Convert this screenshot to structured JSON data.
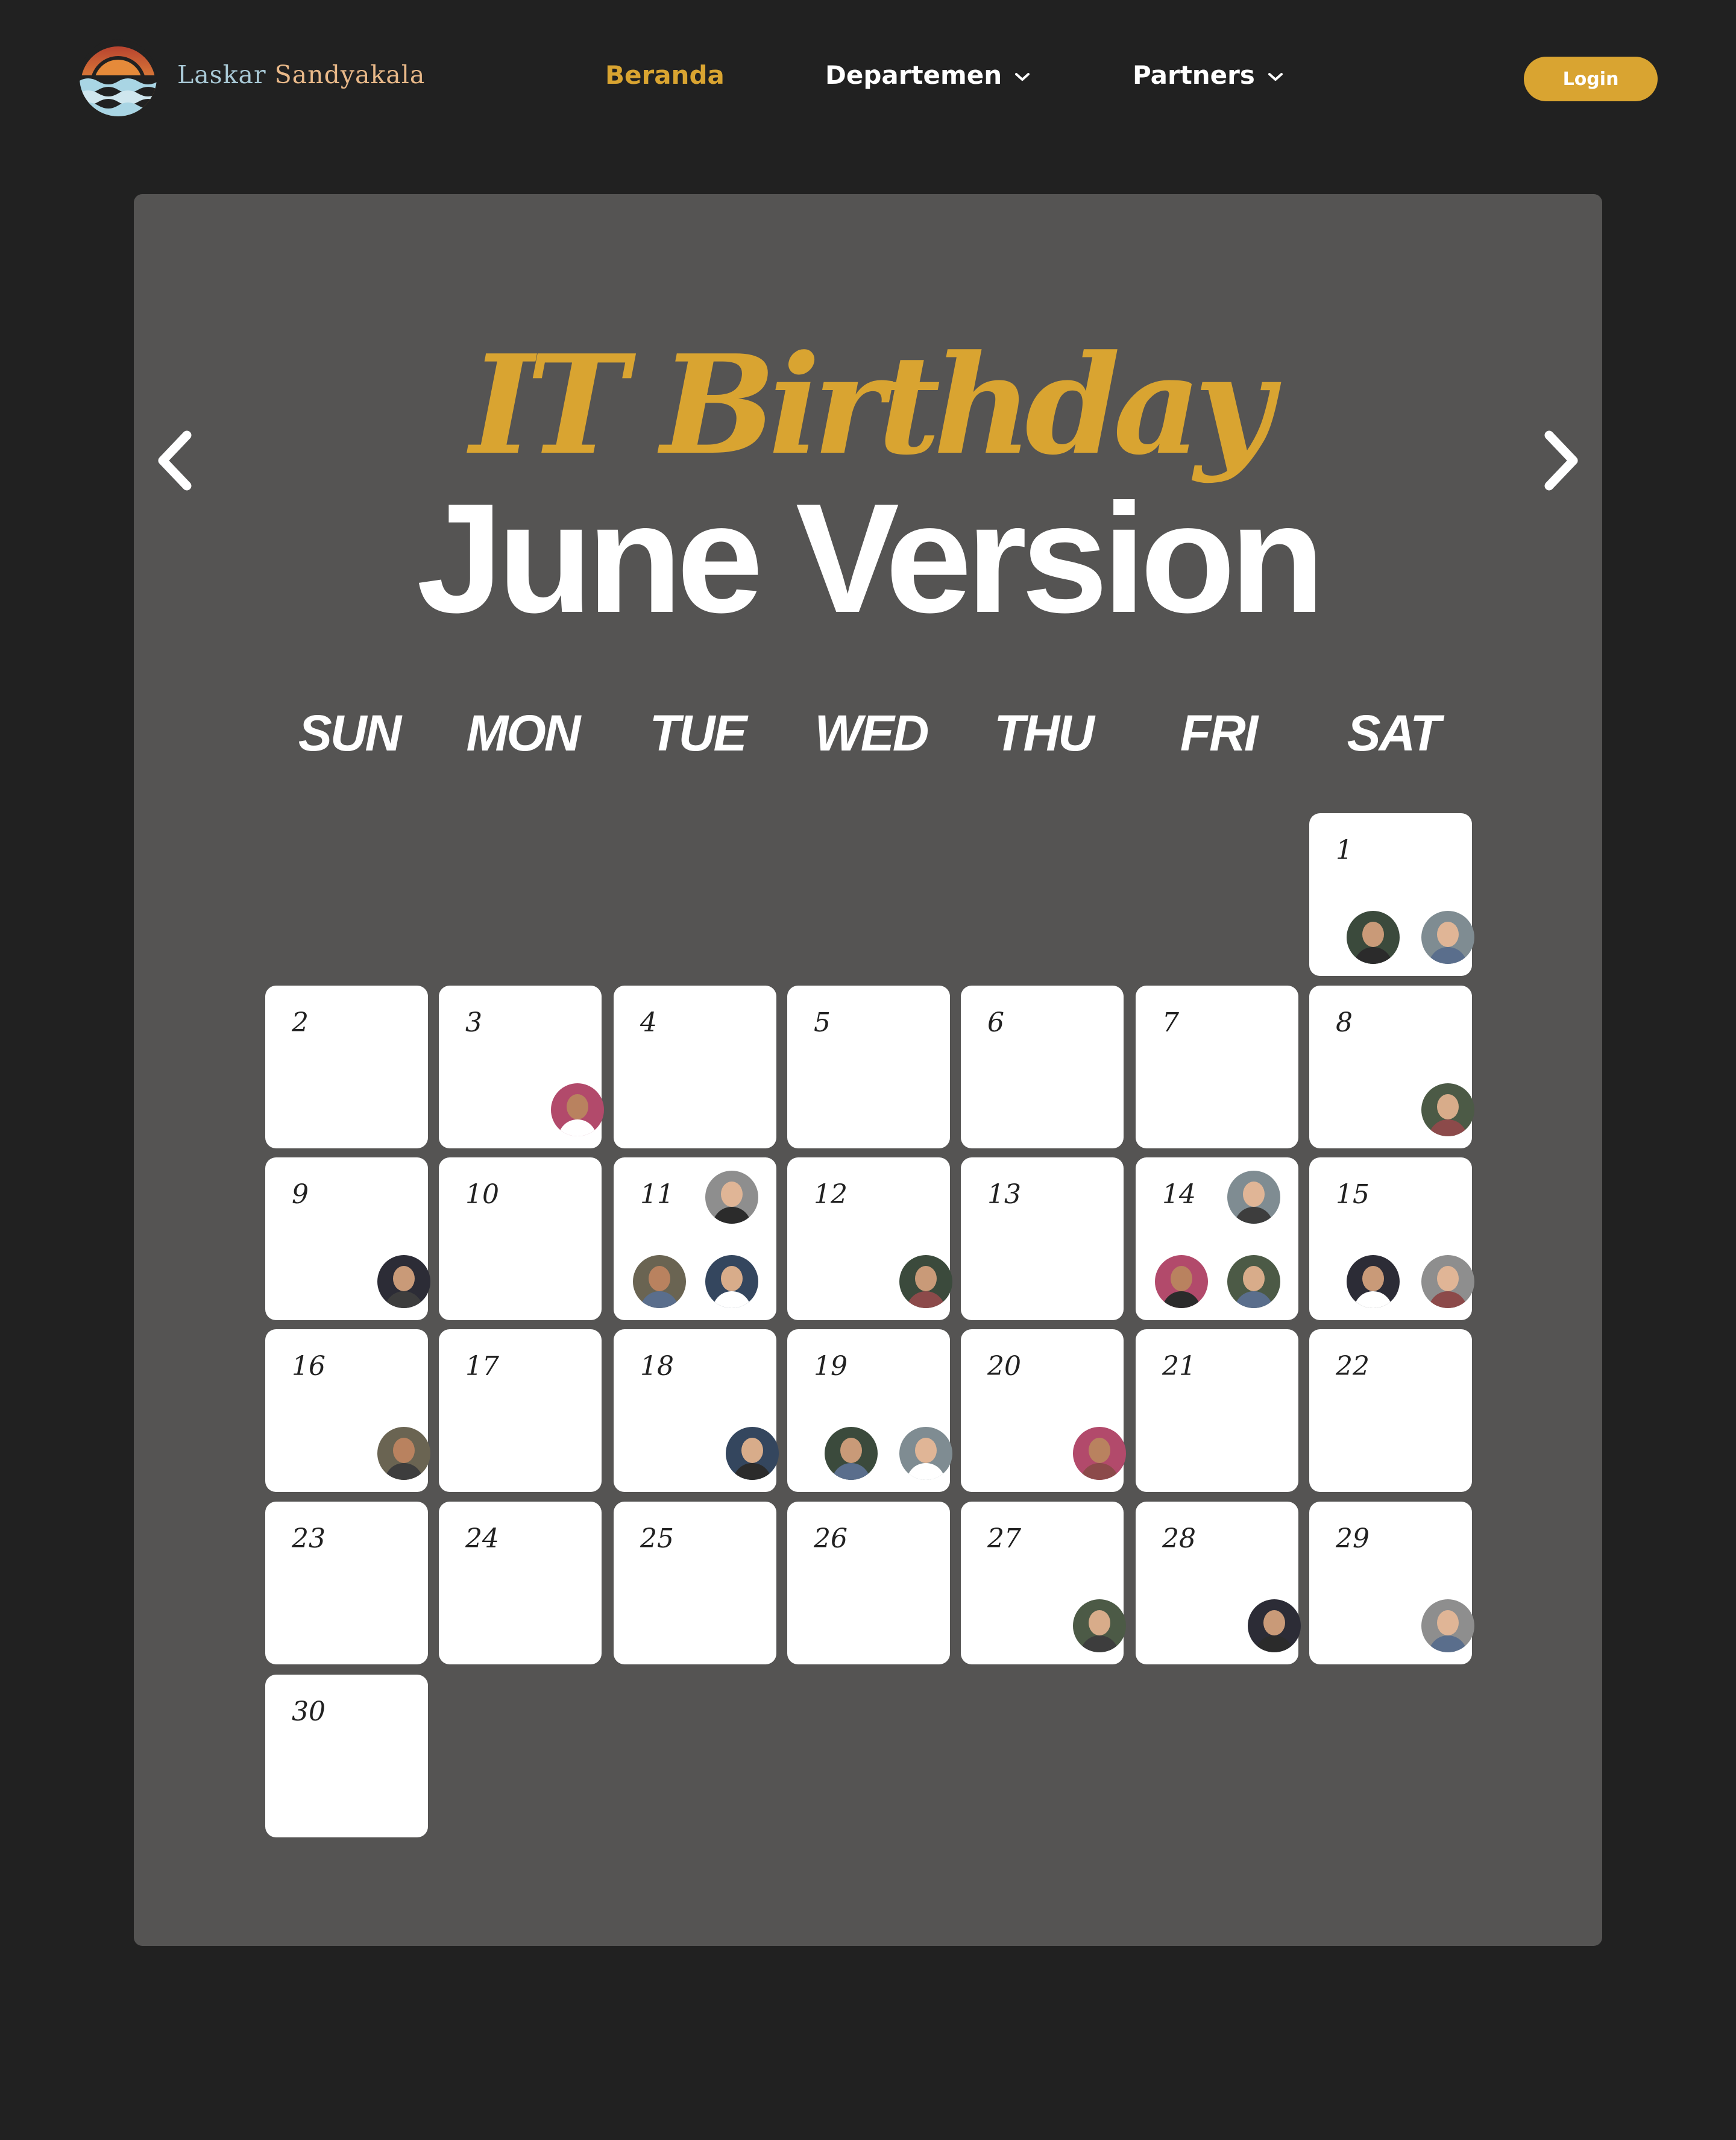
{
  "nav": {
    "brand_first": "Laskar",
    "brand_second": "Sandyakala",
    "links": [
      "Beranda",
      "Departemen",
      "Partners"
    ],
    "login_label": "Login",
    "icons": [
      "sandyakala-logo-icon",
      "chevron-down-icon"
    ],
    "colors": {
      "active": "#d9a431",
      "background": "#212121"
    }
  },
  "calendar": {
    "title_line1": "IT Birthday",
    "title_line2": "June Version",
    "weekdays": [
      "SUN",
      "MON",
      "TUE",
      "WED",
      "THU",
      "FRI",
      "SAT"
    ],
    "days": [
      "1",
      "2",
      "3",
      "4",
      "5",
      "6",
      "7",
      "8",
      "9",
      "10",
      "11",
      "12",
      "13",
      "14",
      "15",
      "16",
      "17",
      "18",
      "19",
      "20",
      "21",
      "22",
      "23",
      "24",
      "25",
      "26",
      "27",
      "28",
      "29",
      "30"
    ],
    "icons": [
      "chevron-left-icon",
      "chevron-right-icon",
      "avatar-photo"
    ],
    "birthday_counts": {
      "1": 2,
      "3": 1,
      "8": 1,
      "9": 1,
      "11": 3,
      "12": 1,
      "14": 3,
      "15": 2,
      "16": 1,
      "18": 1,
      "19": 2,
      "20": 1,
      "27": 1,
      "28": 1,
      "29": 1
    },
    "colors": {
      "panel": "#555453",
      "cell": "#ffffff",
      "title_accent": "#d9a431"
    }
  }
}
